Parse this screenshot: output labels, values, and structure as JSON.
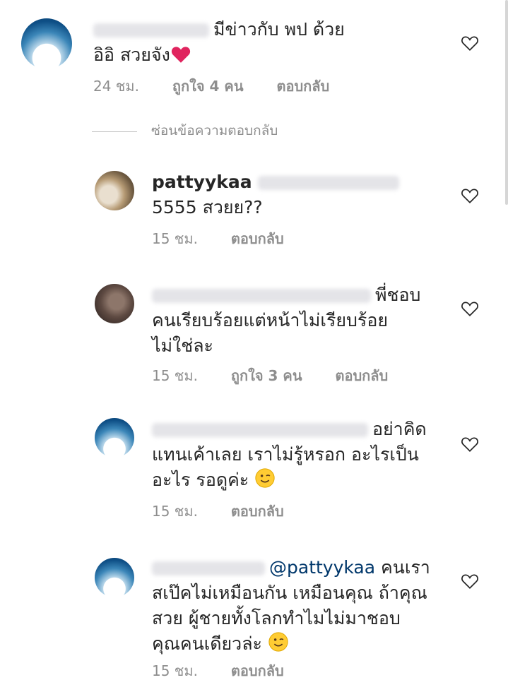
{
  "comments": [
    {
      "text_lines": [
        "มีข่าวกับ พป ด้วย",
        "อิอิ สวยจัง"
      ],
      "time": "24 ชม.",
      "likes": "ถูกใจ 4 คน",
      "reply": "ตอบกลับ"
    },
    {
      "username": "pattyykaa",
      "text_lines": [
        "5555 สวยย??"
      ],
      "time": "15 ชม.",
      "reply": "ตอบกลับ"
    },
    {
      "text_lines": [
        "พี่ชอบ",
        "คนเรียบร้อยแต่หน้าไม่เรียบร้อย",
        "ไม่ใช่ละ"
      ],
      "time": "15 ชม.",
      "likes": "ถูกใจ 3 คน",
      "reply": "ตอบกลับ"
    },
    {
      "text_lines": [
        "อย่าคิด",
        "แทนเค้าเลย เราไม่รู้หรอก อะไรเป็น",
        "อะไร รอดูค่ะ"
      ],
      "time": "15 ชม.",
      "reply": "ตอบกลับ"
    },
    {
      "mention": "@pattyykaa",
      "text_lines": [
        "คนเรา",
        "สเป๊คไม่เหมือนกัน เหมือนคุณ ถ้าคุณ",
        "สวย ผู้ชายทั้งโลกทำไมไม่มาชอบ",
        "คุณคนเดียวล่ะ"
      ],
      "time": "15 ชม.",
      "reply": "ตอบกลับ"
    }
  ],
  "hide_replies_label": "ซ่อนข้อความตอบกลับ",
  "icons": {
    "like": "heart-outline-icon",
    "heart_emoji": "red-heart-emoji",
    "wink_emoji": "winking-face-emoji"
  },
  "colors": {
    "text": "#262626",
    "meta": "#8e8e8e",
    "mention": "#00376b",
    "heart_emoji": "#e0245e"
  }
}
